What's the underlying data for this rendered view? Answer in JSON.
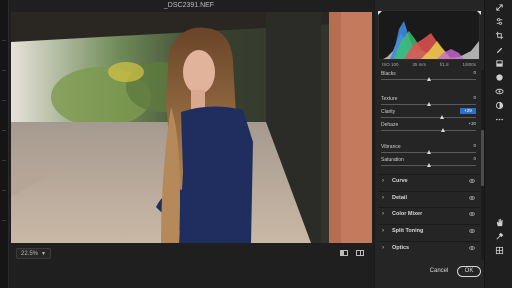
{
  "window": {
    "title": "_DSC2391.NEF"
  },
  "histogram": {
    "iso": "ISO 100",
    "focal_length": "35 mm",
    "aperture": "f/1.8",
    "shutter": "1/800s"
  },
  "sliders": [
    {
      "label": "Blacks",
      "value": "0",
      "level": 0.5,
      "highlighted": false
    },
    {
      "label": "Texture",
      "value": "0",
      "level": 0.5,
      "highlighted": false
    },
    {
      "label": "Clarity",
      "value": "+29",
      "level": 0.64,
      "highlighted": true
    },
    {
      "label": "Dehaze",
      "value": "+30",
      "level": 0.65,
      "highlighted": false
    },
    {
      "label": "Vibrance",
      "value": "0",
      "level": 0.5,
      "highlighted": false
    },
    {
      "label": "Saturation",
      "value": "0",
      "level": 0.5,
      "highlighted": false
    }
  ],
  "sections": [
    {
      "name": "Curve"
    },
    {
      "name": "Detail"
    },
    {
      "name": "Color Mixer"
    },
    {
      "name": "Split Toning"
    },
    {
      "name": "Optics"
    }
  ],
  "bottom": {
    "zoom": "22.5%"
  },
  "actions": {
    "cancel": "Cancel",
    "ok": "OK"
  },
  "tools": [
    "edit-icon",
    "crop-icon",
    "healing-brush-icon",
    "adjustment-brush-icon",
    "graduated-filter-icon",
    "radial-filter-icon",
    "red-eye-icon",
    "snapshots-icon",
    "more-icon",
    "hand-icon",
    "color-sampler-icon",
    "grid-icon"
  ]
}
